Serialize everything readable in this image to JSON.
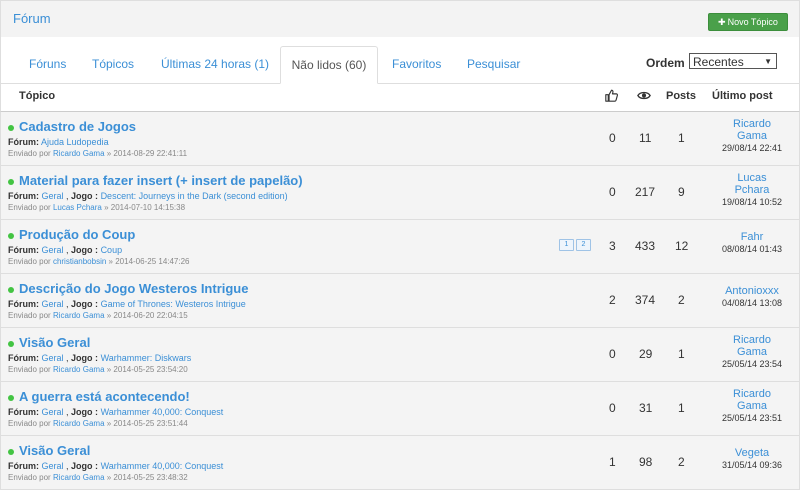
{
  "header": {
    "title": "Fórum",
    "new_topic": "Novo Tópico"
  },
  "tabs": [
    {
      "label": "Fóruns"
    },
    {
      "label": "Tópicos"
    },
    {
      "label": "Últimas 24 horas (1)"
    },
    {
      "label": "Não lidos (60)"
    },
    {
      "label": "Favoritos"
    },
    {
      "label": "Pesquisar"
    }
  ],
  "order": {
    "label": "Ordem",
    "selected": "Recentes"
  },
  "columns": {
    "topic": "Tópico",
    "posts": "Posts",
    "last_post": "Último post"
  },
  "labels": {
    "forum": "Fórum:",
    "game": "Jogo :",
    "sent_by": "Enviado por"
  },
  "topics": [
    {
      "title": "Cadastro de Jogos",
      "forum": "Ajuda Ludopedia",
      "game": null,
      "author": "Ricardo Gama",
      "date": "» 2014-08-29 22:41:11",
      "likes": "0",
      "views": "11",
      "posts": "1",
      "last_user": "Ricardo Gama",
      "last_date": "29/08/14 22:41"
    },
    {
      "title": "Material para fazer insert (+ insert de papelão)",
      "forum": "Geral",
      "game": "Descent: Journeys in the Dark (second edition)",
      "author": "Lucas Pchara",
      "date": "» 2014-07-10 14:15:38",
      "likes": "0",
      "views": "217",
      "posts": "9",
      "last_user": "Lucas Pchara",
      "last_date": "19/08/14 10:52"
    },
    {
      "title": "Produção do Coup",
      "forum": "Geral",
      "game": "Coup",
      "author": "christianbobsin",
      "date": "» 2014-06-25 14:47:26",
      "likes": "3",
      "views": "433",
      "posts": "12",
      "last_user": "Fahr",
      "last_date": "08/08/14 01:43",
      "pages": [
        "1",
        "2"
      ]
    },
    {
      "title": "Descrição do Jogo Westeros Intrigue",
      "forum": "Geral",
      "game": "Game of Thrones: Westeros Intrigue",
      "author": "Ricardo Gama",
      "date": "» 2014-06-20 22:04:15",
      "likes": "2",
      "views": "374",
      "posts": "2",
      "last_user": "Antonioxxx",
      "last_date": "04/08/14 13:08"
    },
    {
      "title": "Visão Geral",
      "forum": "Geral",
      "game": "Warhammer: Diskwars",
      "author": "Ricardo Gama",
      "date": "» 2014-05-25 23:54:20",
      "likes": "0",
      "views": "29",
      "posts": "1",
      "last_user": "Ricardo Gama",
      "last_date": "25/05/14 23:54"
    },
    {
      "title": "A guerra está acontecendo!",
      "forum": "Geral",
      "game": "Warhammer 40,000: Conquest",
      "author": "Ricardo Gama",
      "date": "» 2014-05-25 23:51:44",
      "likes": "0",
      "views": "31",
      "posts": "1",
      "last_user": "Ricardo Gama",
      "last_date": "25/05/14 23:51"
    },
    {
      "title": "Visão Geral",
      "forum": "Geral",
      "game": "Warhammer 40,000: Conquest",
      "author": "Ricardo Gama",
      "date": "» 2014-05-25 23:48:32",
      "likes": "1",
      "views": "98",
      "posts": "2",
      "last_user": "Vegeta",
      "last_date": "31/05/14 09:36"
    }
  ]
}
